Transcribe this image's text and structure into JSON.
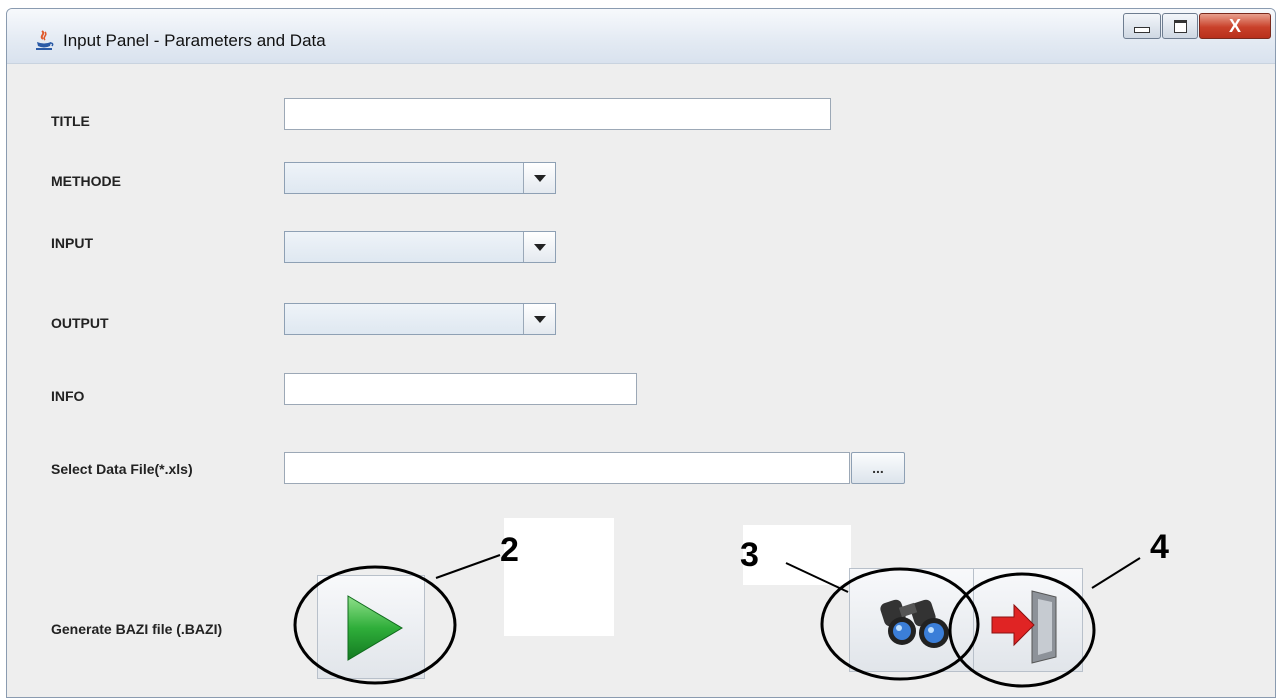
{
  "window": {
    "title": "Input Panel - Parameters and Data",
    "close_glyph": "X",
    "controls": [
      "minimize-icon",
      "maximize-icon",
      "close-icon"
    ]
  },
  "form": {
    "title_label": "TITLE",
    "title_value": "",
    "methode_label": "METHODE",
    "methode_selected": "",
    "input_label": "INPUT",
    "input_selected": "",
    "output_label": "OUTPUT",
    "output_selected": "",
    "info_label": "INFO",
    "info_value": "",
    "file_label": "Select Data File(*.xls)",
    "file_value": "",
    "browse_label": "...",
    "generate_label": "Generate BAZI file (.BAZI)"
  },
  "buttons": {
    "generate_icon": "play-icon",
    "view_icon": "binoculars-icon",
    "exit_icon": "exit-door-icon"
  },
  "annotations": [
    "2",
    "3",
    "4"
  ],
  "colors": {
    "play_green": "#2fae3a",
    "exit_red": "#e02424",
    "close_red": "#c9412a",
    "panel_bg": "#eeeeee"
  }
}
